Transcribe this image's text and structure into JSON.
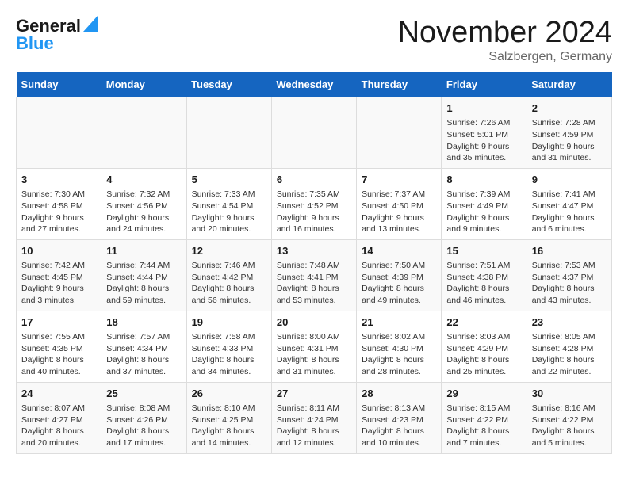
{
  "header": {
    "logo_line1": "General",
    "logo_line2": "Blue",
    "month": "November 2024",
    "location": "Salzbergen, Germany"
  },
  "days_of_week": [
    "Sunday",
    "Monday",
    "Tuesday",
    "Wednesday",
    "Thursday",
    "Friday",
    "Saturday"
  ],
  "weeks": [
    [
      null,
      null,
      null,
      null,
      null,
      {
        "day": "1",
        "sunrise": "Sunrise: 7:26 AM",
        "sunset": "Sunset: 5:01 PM",
        "daylight": "Daylight: 9 hours and 35 minutes."
      },
      {
        "day": "2",
        "sunrise": "Sunrise: 7:28 AM",
        "sunset": "Sunset: 4:59 PM",
        "daylight": "Daylight: 9 hours and 31 minutes."
      }
    ],
    [
      {
        "day": "3",
        "sunrise": "Sunrise: 7:30 AM",
        "sunset": "Sunset: 4:58 PM",
        "daylight": "Daylight: 9 hours and 27 minutes."
      },
      {
        "day": "4",
        "sunrise": "Sunrise: 7:32 AM",
        "sunset": "Sunset: 4:56 PM",
        "daylight": "Daylight: 9 hours and 24 minutes."
      },
      {
        "day": "5",
        "sunrise": "Sunrise: 7:33 AM",
        "sunset": "Sunset: 4:54 PM",
        "daylight": "Daylight: 9 hours and 20 minutes."
      },
      {
        "day": "6",
        "sunrise": "Sunrise: 7:35 AM",
        "sunset": "Sunset: 4:52 PM",
        "daylight": "Daylight: 9 hours and 16 minutes."
      },
      {
        "day": "7",
        "sunrise": "Sunrise: 7:37 AM",
        "sunset": "Sunset: 4:50 PM",
        "daylight": "Daylight: 9 hours and 13 minutes."
      },
      {
        "day": "8",
        "sunrise": "Sunrise: 7:39 AM",
        "sunset": "Sunset: 4:49 PM",
        "daylight": "Daylight: 9 hours and 9 minutes."
      },
      {
        "day": "9",
        "sunrise": "Sunrise: 7:41 AM",
        "sunset": "Sunset: 4:47 PM",
        "daylight": "Daylight: 9 hours and 6 minutes."
      }
    ],
    [
      {
        "day": "10",
        "sunrise": "Sunrise: 7:42 AM",
        "sunset": "Sunset: 4:45 PM",
        "daylight": "Daylight: 9 hours and 3 minutes."
      },
      {
        "day": "11",
        "sunrise": "Sunrise: 7:44 AM",
        "sunset": "Sunset: 4:44 PM",
        "daylight": "Daylight: 8 hours and 59 minutes."
      },
      {
        "day": "12",
        "sunrise": "Sunrise: 7:46 AM",
        "sunset": "Sunset: 4:42 PM",
        "daylight": "Daylight: 8 hours and 56 minutes."
      },
      {
        "day": "13",
        "sunrise": "Sunrise: 7:48 AM",
        "sunset": "Sunset: 4:41 PM",
        "daylight": "Daylight: 8 hours and 53 minutes."
      },
      {
        "day": "14",
        "sunrise": "Sunrise: 7:50 AM",
        "sunset": "Sunset: 4:39 PM",
        "daylight": "Daylight: 8 hours and 49 minutes."
      },
      {
        "day": "15",
        "sunrise": "Sunrise: 7:51 AM",
        "sunset": "Sunset: 4:38 PM",
        "daylight": "Daylight: 8 hours and 46 minutes."
      },
      {
        "day": "16",
        "sunrise": "Sunrise: 7:53 AM",
        "sunset": "Sunset: 4:37 PM",
        "daylight": "Daylight: 8 hours and 43 minutes."
      }
    ],
    [
      {
        "day": "17",
        "sunrise": "Sunrise: 7:55 AM",
        "sunset": "Sunset: 4:35 PM",
        "daylight": "Daylight: 8 hours and 40 minutes."
      },
      {
        "day": "18",
        "sunrise": "Sunrise: 7:57 AM",
        "sunset": "Sunset: 4:34 PM",
        "daylight": "Daylight: 8 hours and 37 minutes."
      },
      {
        "day": "19",
        "sunrise": "Sunrise: 7:58 AM",
        "sunset": "Sunset: 4:33 PM",
        "daylight": "Daylight: 8 hours and 34 minutes."
      },
      {
        "day": "20",
        "sunrise": "Sunrise: 8:00 AM",
        "sunset": "Sunset: 4:31 PM",
        "daylight": "Daylight: 8 hours and 31 minutes."
      },
      {
        "day": "21",
        "sunrise": "Sunrise: 8:02 AM",
        "sunset": "Sunset: 4:30 PM",
        "daylight": "Daylight: 8 hours and 28 minutes."
      },
      {
        "day": "22",
        "sunrise": "Sunrise: 8:03 AM",
        "sunset": "Sunset: 4:29 PM",
        "daylight": "Daylight: 8 hours and 25 minutes."
      },
      {
        "day": "23",
        "sunrise": "Sunrise: 8:05 AM",
        "sunset": "Sunset: 4:28 PM",
        "daylight": "Daylight: 8 hours and 22 minutes."
      }
    ],
    [
      {
        "day": "24",
        "sunrise": "Sunrise: 8:07 AM",
        "sunset": "Sunset: 4:27 PM",
        "daylight": "Daylight: 8 hours and 20 minutes."
      },
      {
        "day": "25",
        "sunrise": "Sunrise: 8:08 AM",
        "sunset": "Sunset: 4:26 PM",
        "daylight": "Daylight: 8 hours and 17 minutes."
      },
      {
        "day": "26",
        "sunrise": "Sunrise: 8:10 AM",
        "sunset": "Sunset: 4:25 PM",
        "daylight": "Daylight: 8 hours and 14 minutes."
      },
      {
        "day": "27",
        "sunrise": "Sunrise: 8:11 AM",
        "sunset": "Sunset: 4:24 PM",
        "daylight": "Daylight: 8 hours and 12 minutes."
      },
      {
        "day": "28",
        "sunrise": "Sunrise: 8:13 AM",
        "sunset": "Sunset: 4:23 PM",
        "daylight": "Daylight: 8 hours and 10 minutes."
      },
      {
        "day": "29",
        "sunrise": "Sunrise: 8:15 AM",
        "sunset": "Sunset: 4:22 PM",
        "daylight": "Daylight: 8 hours and 7 minutes."
      },
      {
        "day": "30",
        "sunrise": "Sunrise: 8:16 AM",
        "sunset": "Sunset: 4:22 PM",
        "daylight": "Daylight: 8 hours and 5 minutes."
      }
    ]
  ]
}
